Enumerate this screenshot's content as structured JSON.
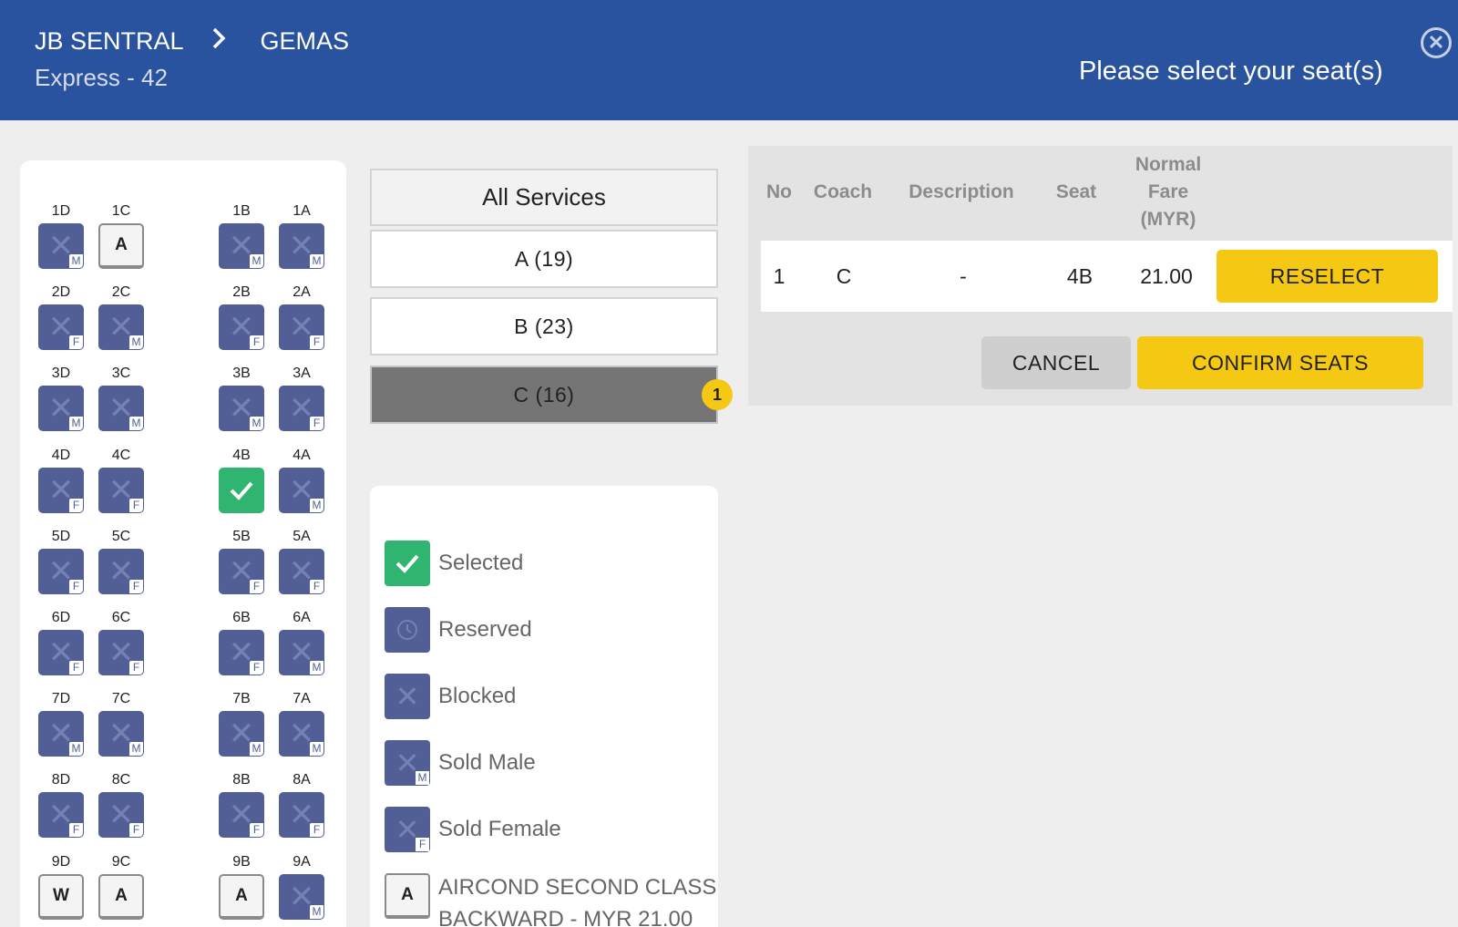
{
  "header": {
    "origin": "JB SENTRAL",
    "destination": "GEMAS",
    "service": "Express - 42",
    "prompt": "Please select your seat(s)"
  },
  "seatmap": {
    "rows": [
      {
        "row": "1",
        "seats": [
          {
            "id": "1D",
            "status": "sold",
            "gender": "M"
          },
          {
            "id": "1C",
            "status": "available",
            "class": "A"
          },
          {
            "id": "1B",
            "status": "sold",
            "gender": "M"
          },
          {
            "id": "1A",
            "status": "sold",
            "gender": "M"
          }
        ]
      },
      {
        "row": "2",
        "seats": [
          {
            "id": "2D",
            "status": "sold",
            "gender": "F"
          },
          {
            "id": "2C",
            "status": "sold",
            "gender": "M"
          },
          {
            "id": "2B",
            "status": "sold",
            "gender": "F"
          },
          {
            "id": "2A",
            "status": "sold",
            "gender": "F"
          }
        ]
      },
      {
        "row": "3",
        "seats": [
          {
            "id": "3D",
            "status": "sold",
            "gender": "M"
          },
          {
            "id": "3C",
            "status": "sold",
            "gender": "M"
          },
          {
            "id": "3B",
            "status": "sold",
            "gender": "M"
          },
          {
            "id": "3A",
            "status": "sold",
            "gender": "F"
          }
        ]
      },
      {
        "row": "4",
        "seats": [
          {
            "id": "4D",
            "status": "sold",
            "gender": "F"
          },
          {
            "id": "4C",
            "status": "sold",
            "gender": "F"
          },
          {
            "id": "4B",
            "status": "selected"
          },
          {
            "id": "4A",
            "status": "sold",
            "gender": "M"
          }
        ]
      },
      {
        "row": "5",
        "seats": [
          {
            "id": "5D",
            "status": "sold",
            "gender": "F"
          },
          {
            "id": "5C",
            "status": "sold",
            "gender": "F"
          },
          {
            "id": "5B",
            "status": "sold",
            "gender": "F"
          },
          {
            "id": "5A",
            "status": "sold",
            "gender": "F"
          }
        ]
      },
      {
        "row": "6",
        "seats": [
          {
            "id": "6D",
            "status": "sold",
            "gender": "F"
          },
          {
            "id": "6C",
            "status": "sold",
            "gender": "F"
          },
          {
            "id": "6B",
            "status": "sold",
            "gender": "F"
          },
          {
            "id": "6A",
            "status": "sold",
            "gender": "M"
          }
        ]
      },
      {
        "row": "7",
        "seats": [
          {
            "id": "7D",
            "status": "sold",
            "gender": "M"
          },
          {
            "id": "7C",
            "status": "sold",
            "gender": "M"
          },
          {
            "id": "7B",
            "status": "sold",
            "gender": "M"
          },
          {
            "id": "7A",
            "status": "sold",
            "gender": "M"
          }
        ]
      },
      {
        "row": "8",
        "seats": [
          {
            "id": "8D",
            "status": "sold",
            "gender": "F"
          },
          {
            "id": "8C",
            "status": "sold",
            "gender": "F"
          },
          {
            "id": "8B",
            "status": "sold",
            "gender": "F"
          },
          {
            "id": "8A",
            "status": "sold",
            "gender": "F"
          }
        ]
      },
      {
        "row": "9",
        "seats": [
          {
            "id": "9D",
            "status": "available",
            "class": "W"
          },
          {
            "id": "9C",
            "status": "available",
            "class": "A"
          },
          {
            "id": "9B",
            "status": "available",
            "class": "A"
          },
          {
            "id": "9A",
            "status": "sold",
            "gender": "M"
          }
        ]
      }
    ]
  },
  "services": {
    "all_label": "All Services",
    "coaches": [
      {
        "label": "A (19)",
        "active": false
      },
      {
        "label": "B (23)",
        "active": false
      },
      {
        "label": "C (16)",
        "active": true,
        "badge": "1"
      }
    ]
  },
  "legend": {
    "selected": "Selected",
    "reserved": "Reserved",
    "blocked": "Blocked",
    "sold_male": "Sold Male",
    "sold_female": "Sold Female",
    "class_code": "A",
    "class_line1": "AIRCOND SECOND CLASS",
    "class_line2": "BACKWARD - MYR 21.00"
  },
  "table": {
    "headers": {
      "no": "No",
      "coach": "Coach",
      "description": "Description",
      "seat": "Seat",
      "fare_1": "Normal",
      "fare_2": "Fare",
      "fare_3": "(MYR)"
    },
    "rows": [
      {
        "no": "1",
        "coach": "C",
        "description": "-",
        "seat": "4B",
        "fare": "21.00",
        "action": "RESELECT"
      }
    ]
  },
  "actions": {
    "cancel": "CANCEL",
    "confirm": "CONFIRM SEATS"
  },
  "colors": {
    "header_bg": "#2a539f",
    "sold_seat": "#515f96",
    "selected_seat": "#2fb56f",
    "accent_yellow": "#f5c913",
    "active_coach": "#757575"
  }
}
